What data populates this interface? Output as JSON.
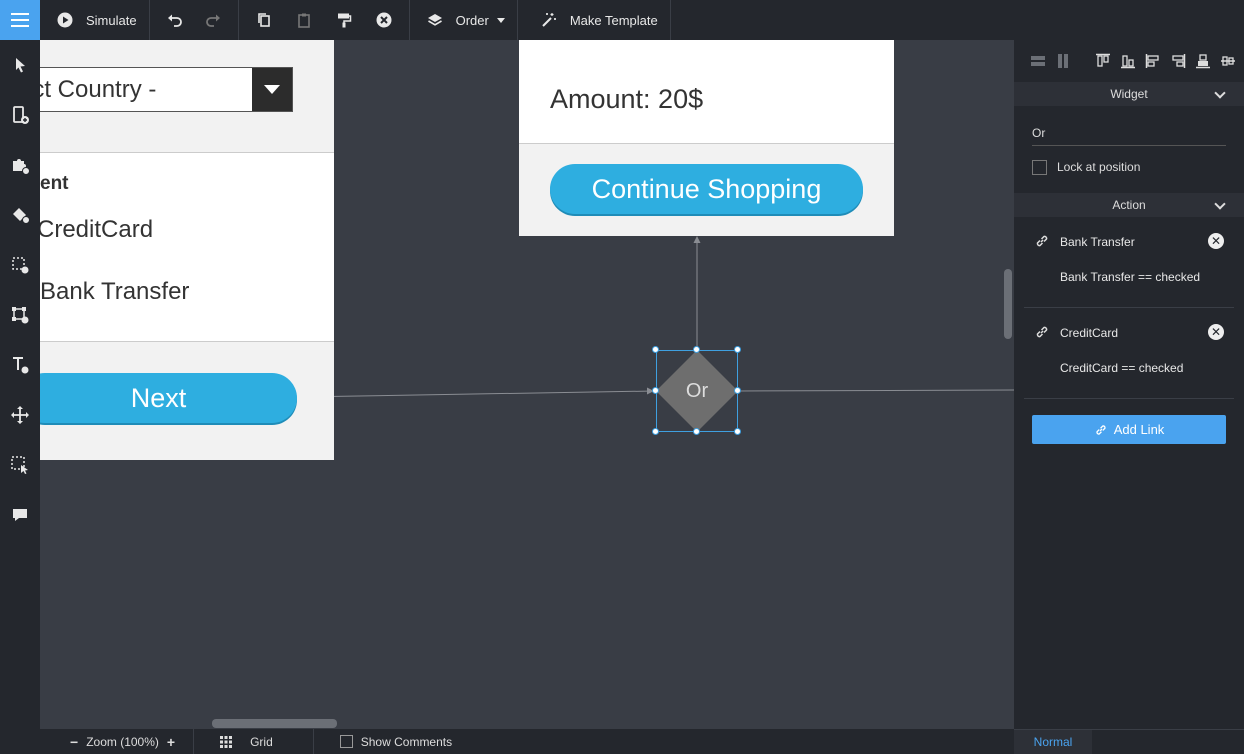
{
  "toolbar": {
    "simulate_label": "Simulate",
    "order_label": "Order",
    "make_template_label": "Make Template"
  },
  "canvas": {
    "left_screen": {
      "select_text": "ect Country -",
      "payment_heading": "ent",
      "option_credit": "CreditCard",
      "option_bank": "Bank Transfer",
      "next_label": "Next"
    },
    "right_screen": {
      "amount_text": "Amount: 20$",
      "continue_label": "Continue Shopping"
    },
    "or_node": {
      "label": "Or"
    }
  },
  "bottombar": {
    "zoom_label": "Zoom (100%)",
    "grid_label": "Grid",
    "show_comments_label": "Show Comments"
  },
  "rpanel": {
    "widget_header": "Widget",
    "widget_name": "Or",
    "lock_label": "Lock at position",
    "action_header": "Action",
    "links": [
      {
        "name": "Bank Transfer",
        "condition": "Bank Transfer == checked"
      },
      {
        "name": "CreditCard",
        "condition": "CreditCard == checked"
      }
    ],
    "add_link_label": "Add Link",
    "mode_label": "Normal"
  },
  "colors": {
    "accent": "#4aa3ef",
    "button": "#2eaee0",
    "dark": "#24272d",
    "canvas": "#393d45"
  }
}
